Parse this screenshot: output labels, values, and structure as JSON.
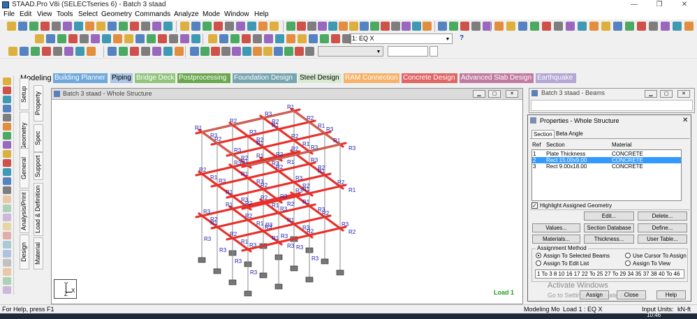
{
  "window": {
    "title": "STAAD.Pro V8i (SELECTseries 6) - Batch 3 staad",
    "minimize": "—",
    "maximize": "❐",
    "close": "✕"
  },
  "menu": [
    "File",
    "Edit",
    "View",
    "Tools",
    "Select",
    "Geometry",
    "Commands",
    "Analyze",
    "Mode",
    "Window",
    "Help"
  ],
  "toolbar": {
    "load_case": "1: EQ X",
    "help_glyph": "?"
  },
  "mode_label": "Modeling",
  "mode_tabs": [
    {
      "label": "Building Planner",
      "bg": "#6fa8dc",
      "fg": "#ffffff"
    },
    {
      "label": "Piping",
      "bg": "#a9c4e4",
      "fg": "#000000"
    },
    {
      "label": "Bridge Deck",
      "bg": "#93c47d",
      "fg": "#ffffff"
    },
    {
      "label": "Postprocessing",
      "bg": "#6aa84f",
      "fg": "#ffffff"
    },
    {
      "label": "Foundation Design",
      "bg": "#76a5af",
      "fg": "#ffffff"
    },
    {
      "label": "Steel Design",
      "bg": "#d9ead3",
      "fg": "#000000"
    },
    {
      "label": "RAM Connection",
      "bg": "#f6b26b",
      "fg": "#ffffff"
    },
    {
      "label": "Concrete Design",
      "bg": "#e06666",
      "fg": "#ffffff"
    },
    {
      "label": "Advanced Slab Design",
      "bg": "#c27ba0",
      "fg": "#ffffff"
    },
    {
      "label": "Earthquake",
      "bg": "#b4a7d6",
      "fg": "#ffffff"
    }
  ],
  "side_tabs_outer": [
    "Setup",
    "Geometry",
    "General",
    "Analysis/Print",
    "Design"
  ],
  "side_tabs_inner": [
    "Property",
    "Spec",
    "Support",
    "Load & Definition",
    "Material"
  ],
  "main_window": {
    "title": "Batch 3 staad - Whole Structure",
    "load_label": "Load 1",
    "axis_y": "Y",
    "axis_x": "X",
    "axis_z": "Z"
  },
  "beams_window": {
    "title": "Batch 3 staad - Beams"
  },
  "properties": {
    "title": "Properties - Whole Structure",
    "tabs": [
      "Section",
      "Beta Angle"
    ],
    "columns": [
      "Ref",
      "Section",
      "Material"
    ],
    "rows": [
      {
        "ref": "1",
        "section": "Plate Thickness",
        "material": "CONCRETE"
      },
      {
        "ref": "2",
        "section": "Rect 15.00x9.00",
        "material": "CONCRETE"
      },
      {
        "ref": "3",
        "section": "Rect 9.00x18.00",
        "material": "CONCRETE"
      }
    ],
    "highlight_label": "Highlight Assigned Geometry",
    "buttons": {
      "edit": "Edit...",
      "delete": "Delete...",
      "values": "Values...",
      "section_db": "Section Database",
      "define": "Define...",
      "materials": "Materials...",
      "thickness": "Thickness...",
      "user_table": "User Table..."
    },
    "assignment_method": "Assignment Method",
    "assign_options": [
      "Assign To Selected Beams",
      "Use Cursor To Assign",
      "Assign To Edit List",
      "Assign To View"
    ],
    "edit_list": "1 To 3 8 10 16 17 22 To 25 27 To 29 34 35 37 38 40 To 46",
    "bottom_buttons": {
      "assign": "Assign",
      "close": "Close",
      "help": "Help"
    },
    "watermark_1": "Activate Windows",
    "watermark_2": "Go to Settings to activate Windows."
  },
  "status": {
    "help": "For Help, press F1",
    "mode": "Modeling Mo",
    "load": "Load 1 : EQ X",
    "units": "Input Units:",
    "unit_value": "kN-ft",
    "clock": "10:46"
  },
  "colors": {
    "beam_red": "#e8302a",
    "label_blue": "#1a1aa6",
    "selection_blue": "#3399ff",
    "load_green": "#19a019"
  }
}
